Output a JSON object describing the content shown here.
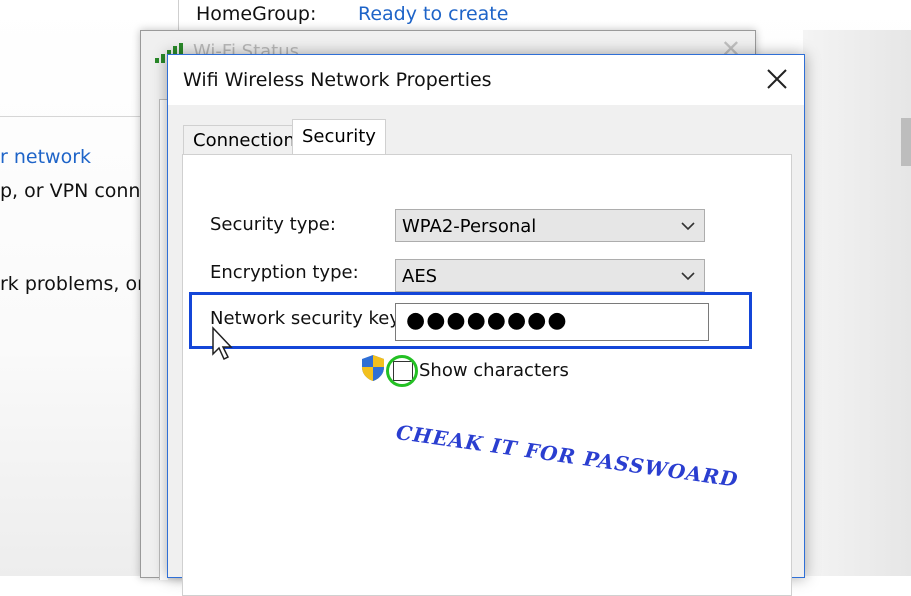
{
  "background": {
    "homegroup_label": "HomeGroup:",
    "homegroup_value": "Ready to create",
    "link_fragment": "r network",
    "text_fragment_1": "p, or VPN conne",
    "text_fragment_2": "rk problems, or"
  },
  "wifi_status_window": {
    "title": "Wi-Fi Status"
  },
  "dialog": {
    "title": "Wifi Wireless Network Properties",
    "tabs": [
      {
        "label": "Connection"
      },
      {
        "label": "Security",
        "selected": true
      }
    ],
    "security_type_label": "Security type:",
    "security_type_value": "WPA2-Personal",
    "encryption_type_label": "Encryption type:",
    "encryption_type_value": "AES",
    "network_key_label": "Network security key",
    "network_key_value": "●●●●●●●●",
    "show_characters_label": "Show characters",
    "show_characters_checked": false
  },
  "annotation": {
    "text": "CHEAK IT FOR PASSWOARD",
    "color": "#2a3ed0"
  },
  "colors": {
    "highlight_box": "#1446d8",
    "checkbox_circle": "#23c023",
    "link": "#1e64c8"
  }
}
